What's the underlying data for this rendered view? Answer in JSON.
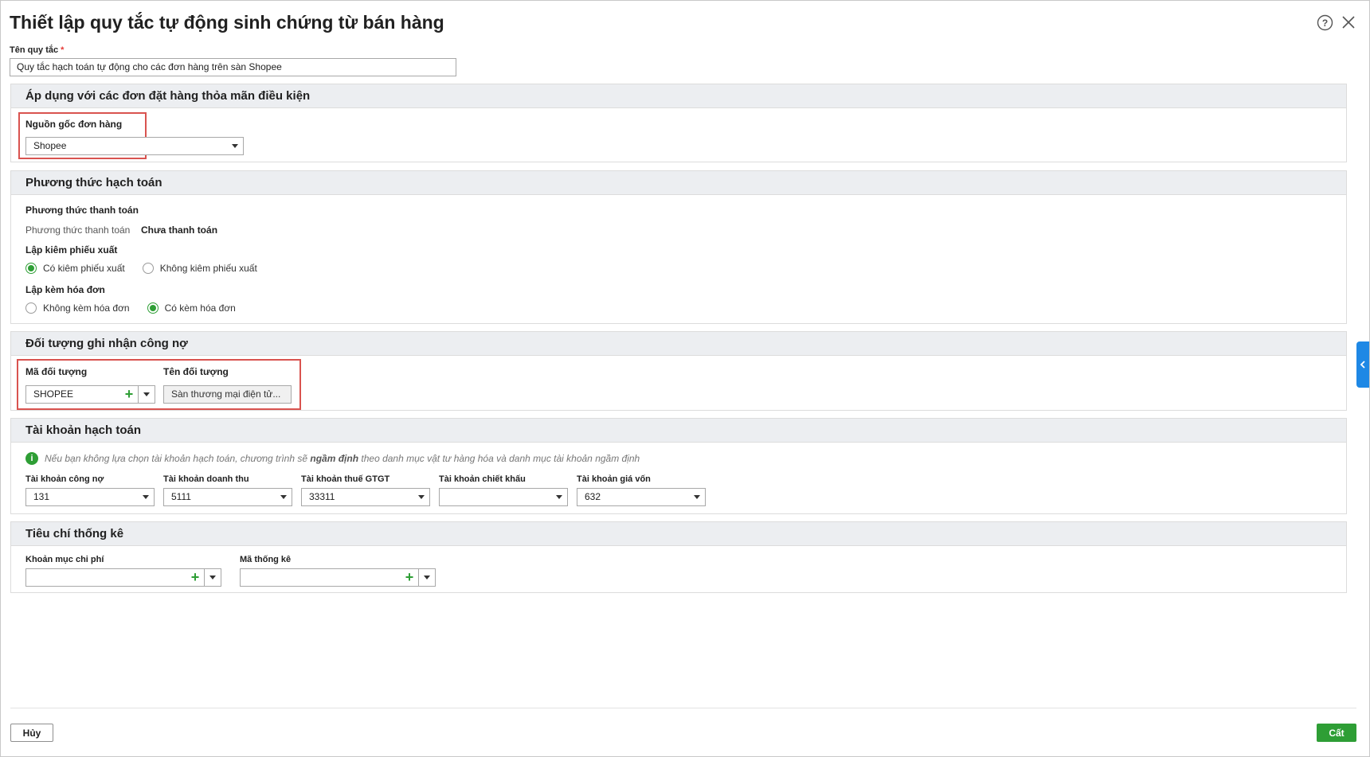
{
  "dialog": {
    "title": "Thiết lập quy tắc tự động sinh chứng từ bán hàng",
    "help_icon": "help-circle-icon",
    "close_icon": "close-icon"
  },
  "rule_name": {
    "label": "Tên quy tắc",
    "required_mark": "*",
    "value": "Quy tắc hạch toán tự động cho các đơn hàng trên sàn Shopee"
  },
  "conditions": {
    "title": "Áp dụng với các đơn đặt hàng thỏa mãn điều kiện",
    "order_source_label": "Nguồn gốc đơn hàng",
    "order_source_value": "Shopee"
  },
  "accounting_method": {
    "title": "Phương thức hạch toán",
    "payment_heading": "Phương thức thanh toán",
    "payment_label": "Phương thức thanh toán",
    "payment_value": "Chưa thanh toán",
    "export_slip_heading": "Lập kiêm phiếu xuất",
    "export_slip_options": [
      {
        "label": "Có kiêm phiếu xuất",
        "selected": true
      },
      {
        "label": "Không kiêm phiếu xuất",
        "selected": false
      }
    ],
    "invoice_heading": "Lập kèm hóa đơn",
    "invoice_options": [
      {
        "label": "Không kèm hóa đơn",
        "selected": false
      },
      {
        "label": "Có kèm hóa đơn",
        "selected": true
      }
    ]
  },
  "debt_object": {
    "title": "Đối tượng ghi nhận công nợ",
    "code_label": "Mã đối tượng",
    "code_value": "SHOPEE",
    "name_label": "Tên đối tượng",
    "name_value": "Sàn thương mại điện tử..."
  },
  "accounts": {
    "title": "Tài khoản hạch toán",
    "info_prefix": "Nếu bạn không lựa chọn tài khoản hạch toán, chương trình sẽ ",
    "info_bold": "ngầm định",
    "info_suffix": " theo danh mục vật tư hàng hóa và danh mục tài khoản ngầm định",
    "fields": [
      {
        "label": "Tài khoản công nợ",
        "value": "131"
      },
      {
        "label": "Tài khoản doanh thu",
        "value": "5111"
      },
      {
        "label": "Tài khoản thuế GTGT",
        "value": "33311"
      },
      {
        "label": "Tài khoản chiết khấu",
        "value": ""
      },
      {
        "label": "Tài khoản giá vốn",
        "value": "632"
      }
    ]
  },
  "statistics": {
    "title": "Tiêu chí thống kê",
    "expense_label": "Khoản mục chi phí",
    "expense_value": "",
    "stat_code_label": "Mã thống kê",
    "stat_code_value": ""
  },
  "footer": {
    "cancel_label": "Hủy",
    "save_label": "Cất"
  },
  "colors": {
    "accent_green": "#2e9e35",
    "highlight_red": "#d9534f",
    "side_tab_blue": "#1e88e5"
  }
}
